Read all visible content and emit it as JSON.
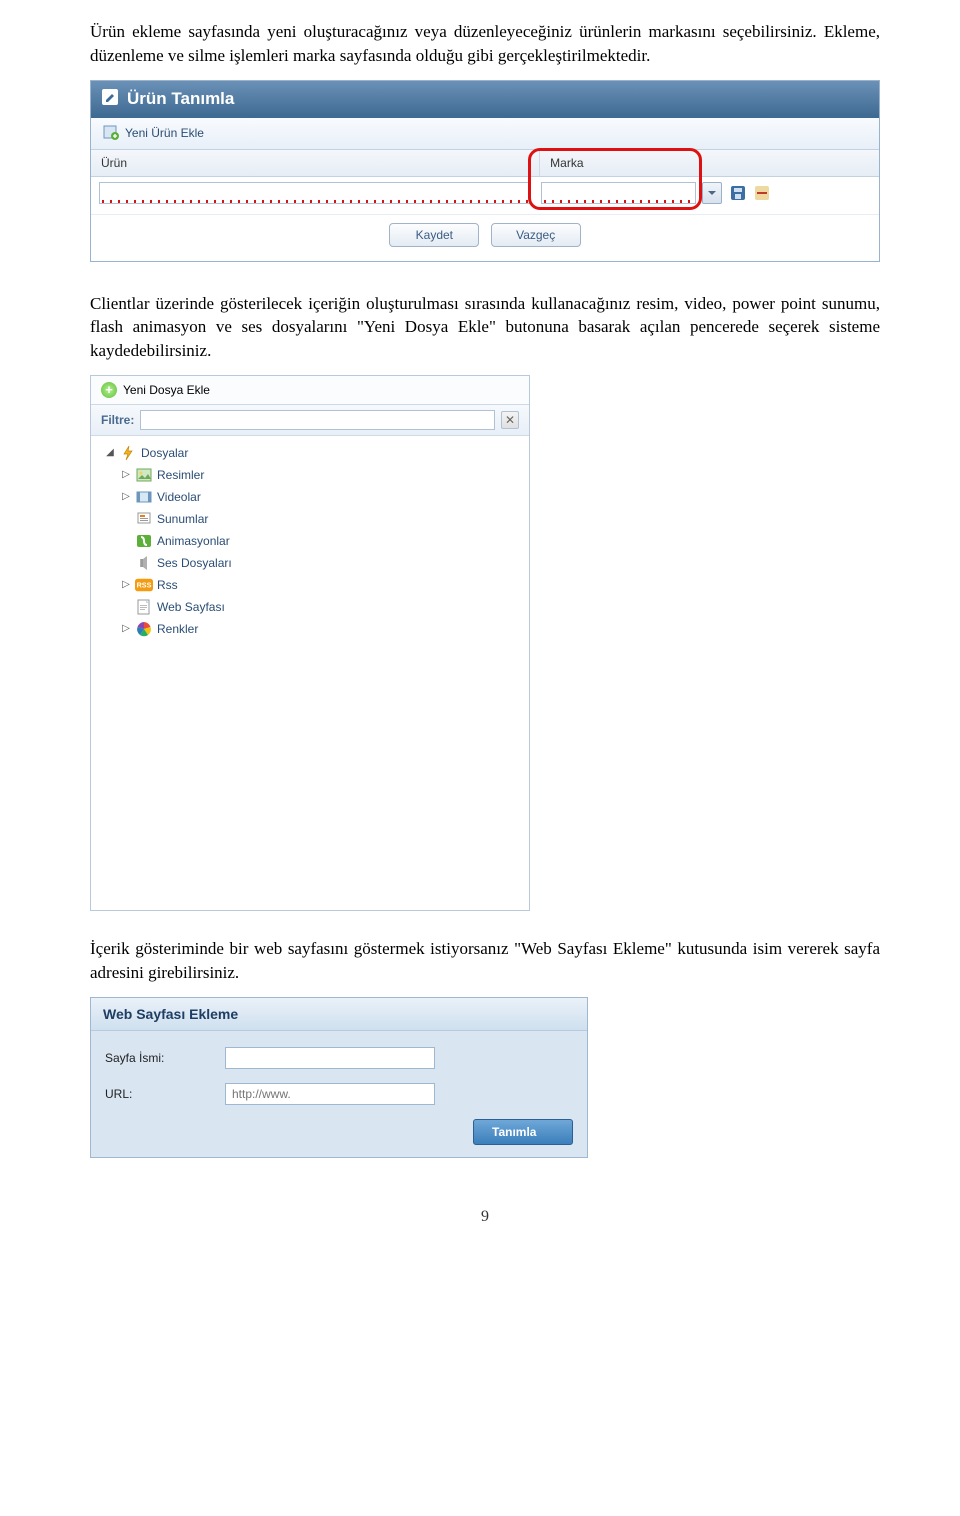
{
  "para1": "Ürün ekleme sayfasında yeni oluşturacağınız veya düzenleyeceğiniz ürünlerin markasını seçebilirsiniz. Ekleme, düzenleme ve silme işlemleri marka sayfasında olduğu gibi gerçekleştirilmektedir.",
  "para2": "Clientlar üzerinde gösterilecek içeriğin oluşturulması sırasında kullanacağınız resim, video, power point sunumu, flash animasyon ve ses dosyalarını \"Yeni Dosya Ekle\" butonuna basarak açılan pencerede seçerek sisteme kaydedebilirsiniz.",
  "para3": "İçerik gösteriminde bir web sayfasını göstermek istiyorsanız \"Web Sayfası Ekleme\" kutusunda isim vererek sayfa adresini girebilirsiniz.",
  "panel1": {
    "title": "Ürün Tanımla",
    "toolbar_add": "Yeni Ürün Ekle",
    "col_urun": "Ürün",
    "col_marka": "Marka",
    "btn_save": "Kaydet",
    "btn_cancel": "Vazgeç"
  },
  "panel2": {
    "add_file_label": "Yeni Dosya Ekle",
    "filter_label": "Filtre:",
    "tree": {
      "root": "Dosyalar",
      "items": [
        "Resimler",
        "Videolar",
        "Sunumlar",
        "Animasyonlar",
        "Ses Dosyaları",
        "Rss",
        "Web Sayfası",
        "Renkler"
      ]
    }
  },
  "panel3": {
    "title": "Web Sayfası Ekleme",
    "label_name": "Sayfa İsmi:",
    "label_url": "URL:",
    "url_placeholder": "http://www.",
    "btn_define": "Tanımla"
  },
  "page_number": "9"
}
